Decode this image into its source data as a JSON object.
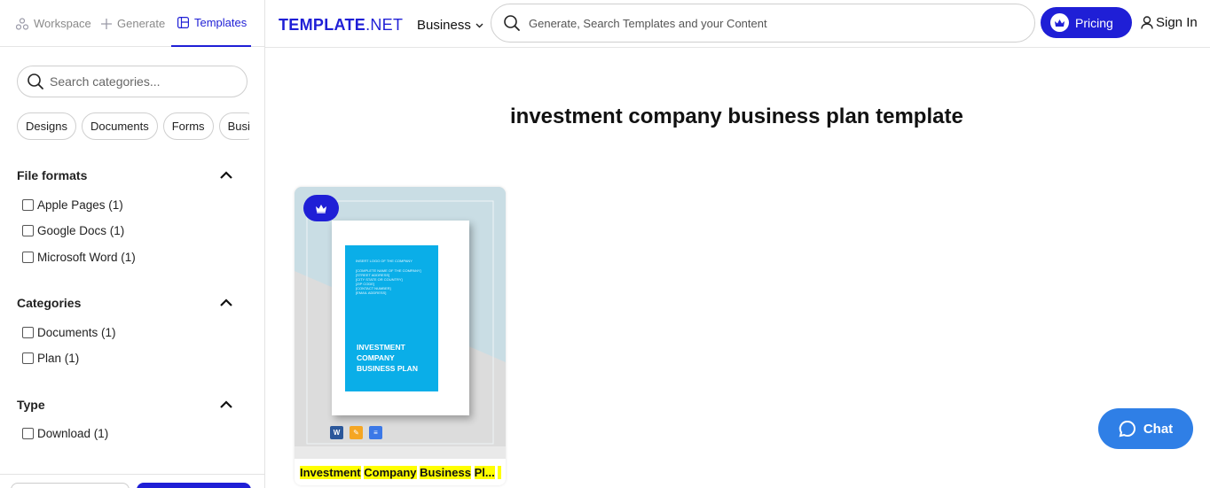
{
  "nav": {
    "tabs": [
      {
        "label": "Workspace",
        "icon": "workspace-icon"
      },
      {
        "label": "Generate",
        "icon": "plus-icon"
      },
      {
        "label": "Templates",
        "icon": "template-icon",
        "active": true
      }
    ]
  },
  "sidebar": {
    "search_placeholder": "Search categories...",
    "chips": [
      "Designs",
      "Documents",
      "Forms",
      "Busi"
    ],
    "sections": [
      {
        "title": "File formats",
        "options": [
          "Apple Pages (1)",
          "Google Docs (1)",
          "Microsoft Word (1)"
        ]
      },
      {
        "title": "Categories",
        "options": [
          "Documents (1)",
          "Plan (1)"
        ]
      },
      {
        "title": "Type",
        "options": [
          "Download (1)"
        ]
      }
    ]
  },
  "header": {
    "logo_main": "TEMPLATE",
    "logo_suffix": ".NET",
    "business_label": "Business",
    "search_placeholder": "Generate, Search Templates and your Content",
    "pricing_label": "Pricing",
    "signin_label": "Sign In"
  },
  "main": {
    "page_title": "investment company business plan template",
    "card": {
      "cover_title_line1": "INVESTMENT",
      "cover_title_line2": "COMPANY",
      "cover_title_line3": "BUSINESS PLAN",
      "title_words": [
        "Investment",
        "Company",
        "Business",
        "Pl..."
      ]
    }
  },
  "chat": {
    "label": "Chat"
  },
  "colors": {
    "brand": "#1f1fd6",
    "chat": "#2f7fe6",
    "cover": "#0aaee8",
    "highlight": "#ffff00"
  }
}
